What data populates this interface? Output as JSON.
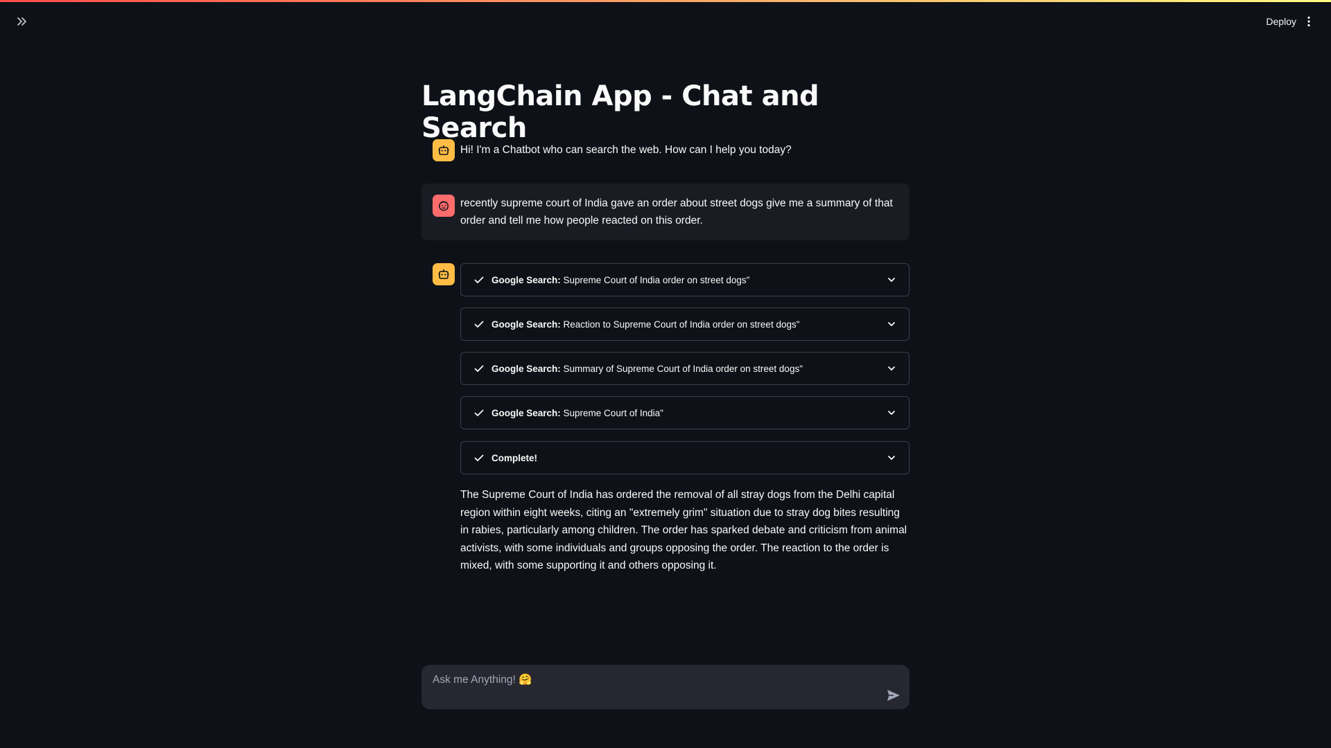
{
  "header": {
    "deploy_label": "Deploy"
  },
  "page": {
    "title": "LangChain App - Chat and Search"
  },
  "messages": {
    "assistant_greeting": "Hi! I'm a Chatbot who can search the web. How can I help you today?",
    "user_query": "recently supreme court of India gave an order about street dogs give me a summary of that order and tell me how people reacted on this order.",
    "steps": [
      {
        "prefix": "Google Search:",
        "query": " Supreme Court of India order on street dogs\""
      },
      {
        "prefix": "Google Search:",
        "query": " Reaction to Supreme Court of India order on street dogs\""
      },
      {
        "prefix": "Google Search:",
        "query": " Summary of Supreme Court of India order on street dogs\""
      },
      {
        "prefix": "Google Search:",
        "query": " Supreme Court of India\""
      },
      {
        "prefix": "Complete!",
        "query": ""
      }
    ],
    "answer": "The Supreme Court of India has ordered the removal of all stray dogs from the Delhi capital region within eight weeks, citing an \"extremely grim\" situation due to stray dog bites resulting in rabies, particularly among children. The order has sparked debate and criticism from animal activists, with some individuals and groups opposing the order. The reaction to the order is mixed, with some supporting it and others opposing it."
  },
  "chat_input": {
    "placeholder": "Ask me Anything! 🤗"
  },
  "colors": {
    "background": "#0e1117",
    "assistant_avatar": "#ffbd45",
    "user_avatar": "#ff6c6c",
    "user_bubble": "#1a1c24",
    "input_background": "#262730"
  },
  "icons": {
    "expand": "double-chevron-right-icon",
    "menu": "vertical-dots-icon",
    "assistant": "robot-icon",
    "user": "smiley-face-icon",
    "step_status": "check-icon",
    "step_toggle": "chevron-down-icon",
    "send": "send-arrow-icon"
  }
}
